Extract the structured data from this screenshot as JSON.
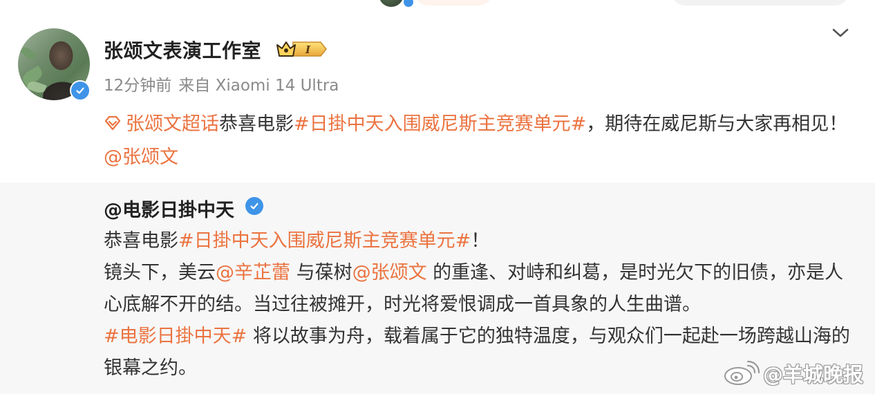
{
  "post": {
    "author": "张颂文表演工作室",
    "time": "12分钟前",
    "source": "来自 Xiaomi 14 Ultra",
    "vip_level": "I",
    "text": {
      "supertopic": "张颂文超话",
      "plain1": "恭喜电影",
      "hashtag": "#日掛中天入围威尼斯主竞赛单元#",
      "plain2": "，期待在威尼斯与大家再相见！",
      "mention": "@张颂文"
    }
  },
  "repost": {
    "author": "@电影日掛中天",
    "line1": {
      "plain1": "恭喜电影",
      "hashtag": "#日掛中天入围威尼斯主竞赛单元#",
      "plain2": "！"
    },
    "line2": {
      "plain1": "镜头下，美云",
      "mention1": "@辛芷蕾",
      "plain2": " 与葆树",
      "mention2": "@张颂文",
      "plain3": " 的重逢、对峙和纠葛，是时光欠下的旧债，亦是人心底解不开的结。当过往被摊开，时光将爱恨调成一首具象的人生曲谱。"
    },
    "line3": {
      "hashtag": "#电影日掛中天#",
      "plain1": " 将以故事为舟，载着属于它的独特温度，与观众们一起赴一场跨越山海的银幕之约。"
    }
  },
  "watermark": {
    "text": "@羊城晚报"
  },
  "colors": {
    "link": "#eb7340",
    "verified": "#3f94e8",
    "repost_bg": "#f7f7f7",
    "meta": "#8a8a8a"
  },
  "icons": [
    "verified-icon",
    "vip-crown-icon",
    "chevron-down-icon",
    "supertopic-icon",
    "weibo-logo-icon"
  ]
}
